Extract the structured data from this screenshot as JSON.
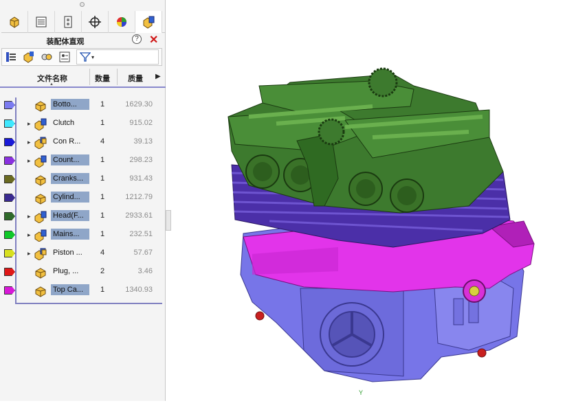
{
  "panel": {
    "title": "装配体直观",
    "tabs": [
      "featuremanager-tab",
      "propertymanager-tab",
      "configurationmanager-tab",
      "dimxpert-tab",
      "displaymanager-tab",
      "assembly-visualization-tab"
    ],
    "columns": {
      "name": "文件名称",
      "qty": "数量",
      "mass": "质量"
    },
    "rows": [
      {
        "name": "Botto...",
        "qty": "1",
        "mass": "1629.30",
        "color": "#7b7bf0",
        "expand": false,
        "icon": "part"
      },
      {
        "name": "Clutch",
        "qty": "1",
        "mass": "915.02",
        "color": "#40e8ff",
        "expand": true,
        "icon": "assembly"
      },
      {
        "name": "Con R...",
        "qty": "4",
        "mass": "39.13",
        "color": "#1a1ad8",
        "expand": true,
        "icon": "assembly-multi"
      },
      {
        "name": "Count...",
        "qty": "1",
        "mass": "298.23",
        "color": "#8a30e0",
        "expand": true,
        "icon": "assembly"
      },
      {
        "name": "Cranks...",
        "qty": "1",
        "mass": "931.43",
        "color": "#6a6a20",
        "expand": false,
        "icon": "part"
      },
      {
        "name": "Cylind...",
        "qty": "1",
        "mass": "1212.79",
        "color": "#3a2a90",
        "expand": false,
        "icon": "part"
      },
      {
        "name": "Head(F...",
        "qty": "1",
        "mass": "2933.61",
        "color": "#2f6a2a",
        "expand": true,
        "icon": "assembly"
      },
      {
        "name": "Mains...",
        "qty": "1",
        "mass": "232.51",
        "color": "#10c828",
        "expand": true,
        "icon": "assembly"
      },
      {
        "name": "Piston ...",
        "qty": "4",
        "mass": "57.67",
        "color": "#d8e020",
        "expand": true,
        "icon": "assembly-multi"
      },
      {
        "name": "Plug, ...",
        "qty": "2",
        "mass": "3.46",
        "color": "#e01818",
        "expand": false,
        "icon": "part"
      },
      {
        "name": "Top Ca...",
        "qty": "1",
        "mass": "1340.93",
        "color": "#d818d8",
        "expand": false,
        "icon": "part"
      }
    ]
  },
  "colors": {
    "head": "#3d7a2e",
    "cylinder": "#4a2ea8",
    "crankcase_upper": "#e030e8",
    "crankcase_lower": "#7a78e8"
  }
}
